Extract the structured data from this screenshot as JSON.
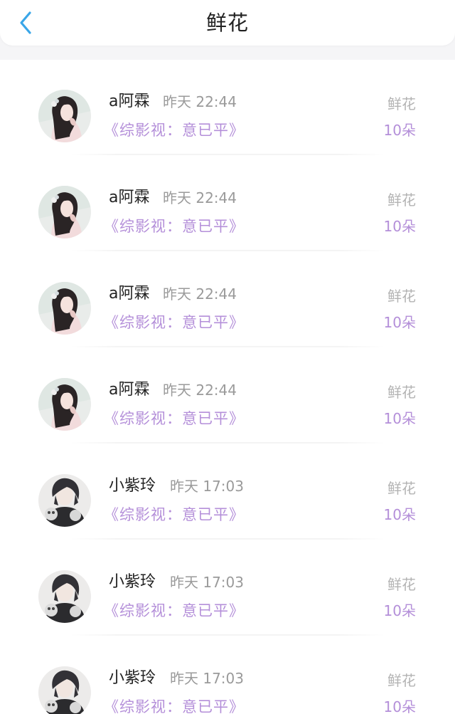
{
  "header": {
    "title": "鲜花"
  },
  "colors": {
    "accent_back": "#3aa6e8",
    "book_title": "#b48fd9",
    "timestamp": "#9a9a9a"
  },
  "records": [
    {
      "avatar": "girl-avatar",
      "name": "a阿霖",
      "time": "昨天 22:44",
      "book": "《综影视：意已平》",
      "gift_type": "鲜花",
      "gift_count": "10朵"
    },
    {
      "avatar": "girl-avatar",
      "name": "a阿霖",
      "time": "昨天 22:44",
      "book": "《综影视：意已平》",
      "gift_type": "鲜花",
      "gift_count": "10朵"
    },
    {
      "avatar": "girl-avatar",
      "name": "a阿霖",
      "time": "昨天 22:44",
      "book": "《综影视：意已平》",
      "gift_type": "鲜花",
      "gift_count": "10朵"
    },
    {
      "avatar": "girl-avatar",
      "name": "a阿霖",
      "time": "昨天 22:44",
      "book": "《综影视：意已平》",
      "gift_type": "鲜花",
      "gift_count": "10朵"
    },
    {
      "avatar": "boy-avatar",
      "name": "小紫玲",
      "time": "昨天 17:03",
      "book": "《综影视：意已平》",
      "gift_type": "鲜花",
      "gift_count": "10朵"
    },
    {
      "avatar": "boy-avatar",
      "name": "小紫玲",
      "time": "昨天 17:03",
      "book": "《综影视：意已平》",
      "gift_type": "鲜花",
      "gift_count": "10朵"
    },
    {
      "avatar": "boy-avatar",
      "name": "小紫玲",
      "time": "昨天 17:03",
      "book": "《综影视：意已平》",
      "gift_type": "鲜花",
      "gift_count": "10朵"
    }
  ]
}
